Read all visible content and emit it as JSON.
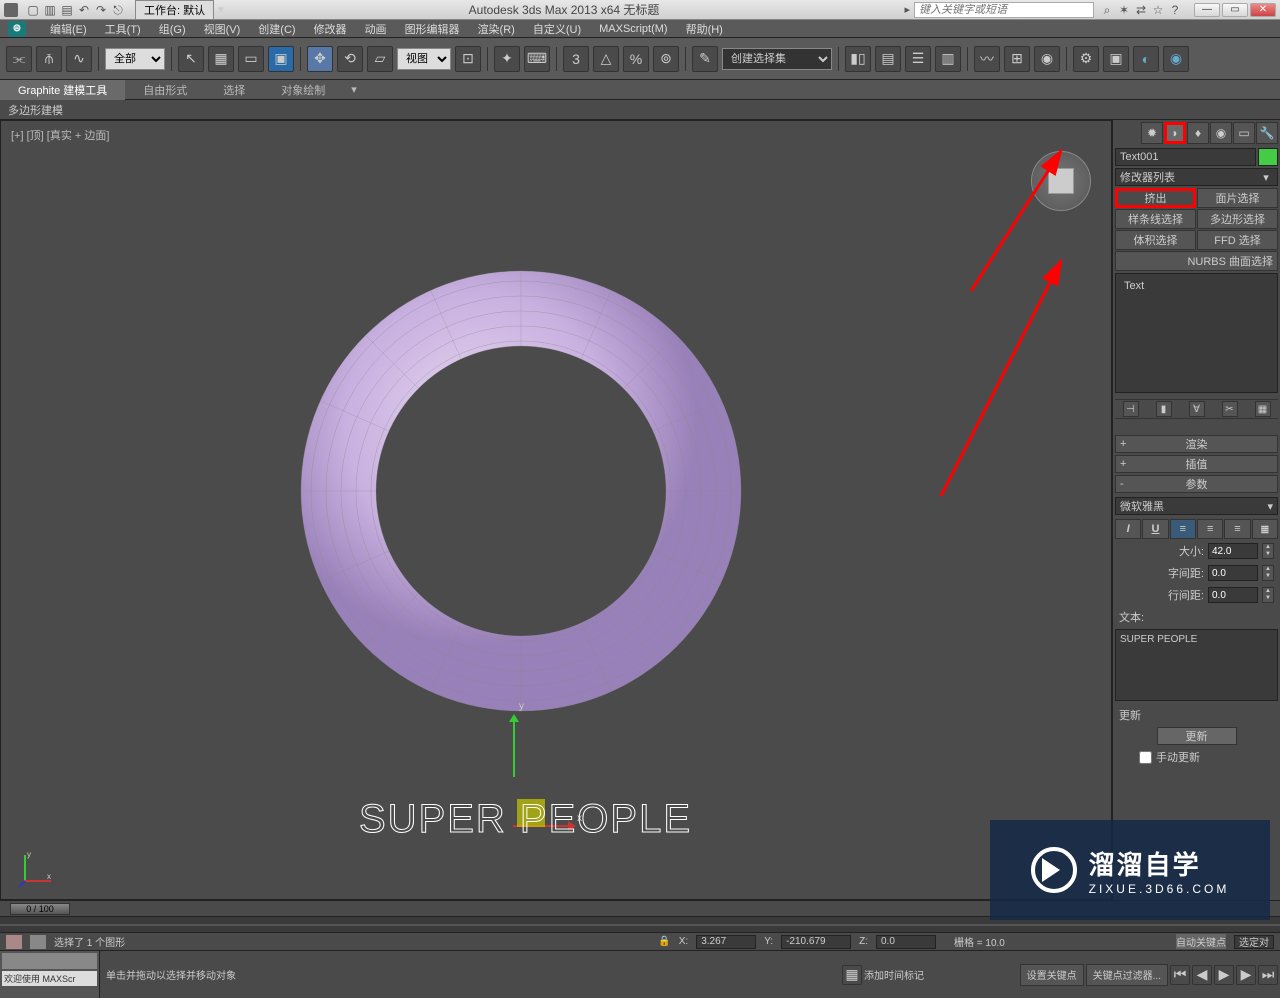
{
  "titlebar": {
    "workspace_label": "工作台: 默认",
    "title": "Autodesk 3ds Max  2013 x64     无标题",
    "search_placeholder": "键入关键字或短语"
  },
  "menubar": {
    "items": [
      "编辑(E)",
      "工具(T)",
      "组(G)",
      "视图(V)",
      "创建(C)",
      "修改器",
      "动画",
      "图形编辑器",
      "渲染(R)",
      "自定义(U)",
      "MAXScript(M)",
      "帮助(H)"
    ]
  },
  "toolbar": {
    "filter_drop": "全部",
    "view_drop": "视图",
    "selset_drop": "创建选择集"
  },
  "ribbon": {
    "tabs": [
      "Graphite 建模工具",
      "自由形式",
      "选择",
      "对象绘制"
    ],
    "sublabel": "多边形建模"
  },
  "viewport": {
    "label": "[+] [顶] [真实 + 边面]",
    "text_object": "SUPER PEOPLE",
    "axis_x": "x",
    "axis_y": "y"
  },
  "cmdpanel": {
    "object_name": "Text001",
    "modlist_label": "修改器列表",
    "mods": {
      "extrude": "挤出",
      "face_sel": "面片选择",
      "spline_sel": "样条线选择",
      "poly_sel": "多边形选择",
      "vol_sel": "体积选择",
      "ffd_sel": "FFD 选择",
      "nurbs": "NURBS 曲面选择"
    },
    "stack_item": "Text",
    "rollouts": {
      "render": "渲染",
      "interp": "插值",
      "params": "参数"
    },
    "font": "微软雅黑",
    "size_label": "大小:",
    "size_val": "42.0",
    "kerning_label": "字间距:",
    "kerning_val": "0.0",
    "leading_label": "行间距:",
    "leading_val": "0.0",
    "text_label": "文本:",
    "text_val": "SUPER PEOPLE",
    "update_section": "更新",
    "update_btn": "更新",
    "manual_update": "手动更新"
  },
  "timeline": {
    "slider": "0 / 100"
  },
  "statusbar": {
    "selection": "选择了 1 个图形",
    "x_label": "X:",
    "x_val": "3.267",
    "y_label": "Y:",
    "y_val": "-210.679",
    "z_label": "Z:",
    "z_val": "0.0",
    "grid": "栅格 = 10.0",
    "autokey": "自动关键点",
    "selected": "选定对"
  },
  "bottombar": {
    "welcome": "欢迎使用  MAXScr",
    "hint": "单击并拖动以选择并移动对象",
    "addtime": "添加时间标记",
    "setkey": "设置关键点",
    "keyfilter": "关键点过滤器..."
  },
  "watermark": {
    "big": "溜溜自学",
    "small": "ZIXUE.3D66.COM"
  }
}
